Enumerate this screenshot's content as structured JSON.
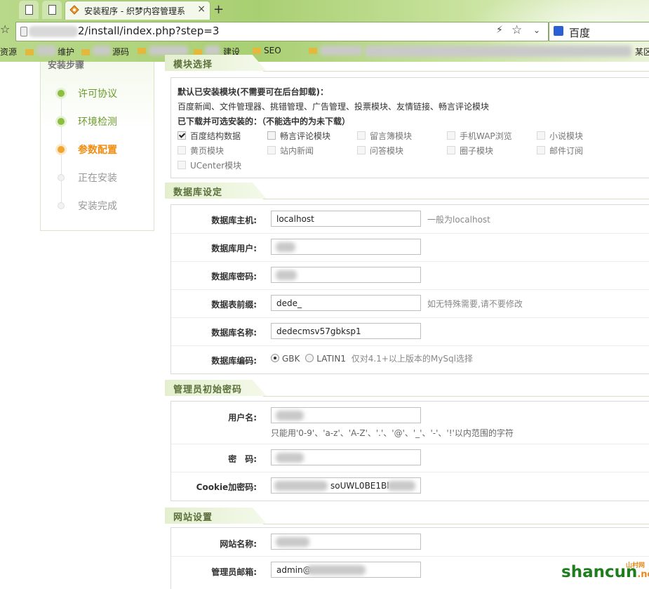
{
  "browser": {
    "tab_title": "安装程序 - 织梦内容管理系",
    "url": "2/install/index.php?step=3",
    "search_engine": "百度",
    "bookmarks": [
      "资源",
      "维护",
      "源码",
      "建设",
      "SEO",
      "某区"
    ]
  },
  "steps": {
    "title": "安装步骤",
    "items": [
      {
        "label": "许可协议",
        "state": "done"
      },
      {
        "label": "环境检测",
        "state": "done"
      },
      {
        "label": "参数配置",
        "state": "current"
      },
      {
        "label": "正在安装",
        "state": "pending"
      },
      {
        "label": "安装完成",
        "state": "pending"
      }
    ]
  },
  "modules": {
    "heading": "模块选择",
    "installed_title": "默认已安装模块(不需要可在后台卸载)：",
    "installed_list": "百度新闻、文件管理器、挑错管理、广告管理、投票模块、友情链接、畅言评论模块",
    "optional_title": "已下载并可选安装的：（不能选中的为未下载）",
    "options": [
      {
        "label": "百度结构数据",
        "checked": true,
        "enabled": true
      },
      {
        "label": "畅言评论模块",
        "checked": false,
        "enabled": true
      },
      {
        "label": "留言簿模块",
        "checked": false,
        "enabled": false
      },
      {
        "label": "手机WAP浏览",
        "checked": false,
        "enabled": false
      },
      {
        "label": "小说模块",
        "checked": false,
        "enabled": false
      },
      {
        "label": "黄页模块",
        "checked": false,
        "enabled": false
      },
      {
        "label": "站内新闻",
        "checked": false,
        "enabled": false
      },
      {
        "label": "问答模块",
        "checked": false,
        "enabled": false
      },
      {
        "label": "圈子模块",
        "checked": false,
        "enabled": false
      },
      {
        "label": "邮件订阅",
        "checked": false,
        "enabled": false
      },
      {
        "label": "UCenter模块",
        "checked": false,
        "enabled": false
      }
    ]
  },
  "database": {
    "heading": "数据库设定",
    "host_label": "数据库主机:",
    "host_value": "localhost",
    "host_hint": "一般为localhost",
    "user_label": "数据库用户:",
    "password_label": "数据库密码:",
    "prefix_label": "数据表前缀:",
    "prefix_value": "dede_",
    "prefix_hint": "如无特殊需要,请不要修改",
    "name_label": "数据库名称:",
    "name_value": "dedecmsv57gbksp1",
    "charset_label": "数据库编码:",
    "charset_gbk": "GBK",
    "charset_latin": "LATIN1",
    "charset_hint": "仅对4.1+以上版本的MySql选择"
  },
  "admin": {
    "heading": "管理员初始密码",
    "username_label": "用户名:",
    "username_hint": "只能用'0-9'、'a-z'、'A-Z'、'.'、'@'、'_'、'-'、'!'以内范围的字符",
    "password_label": "密　码:",
    "cookie_label": "Cookie加密码:",
    "cookie_value_visible": "soUWL0BE1Bl"
  },
  "site": {
    "heading": "网站设置",
    "name_label": "网站名称:",
    "email_label": "管理员邮箱:",
    "email_value_visible": "admin@"
  },
  "watermark": {
    "brand": "shancun",
    "tld": ".net",
    "cn": "山村网"
  }
}
